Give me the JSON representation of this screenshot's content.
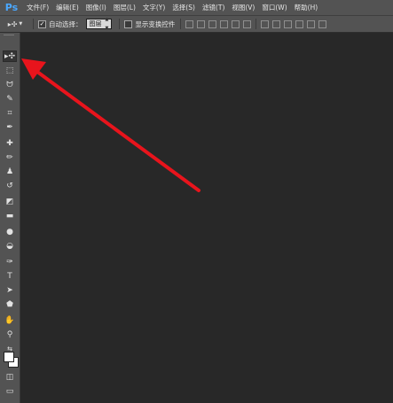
{
  "app": {
    "logo": "Ps"
  },
  "menu": [
    {
      "label": "文件(F)"
    },
    {
      "label": "编辑(E)"
    },
    {
      "label": "图像(I)"
    },
    {
      "label": "图层(L)"
    },
    {
      "label": "文字(Y)"
    },
    {
      "label": "选择(S)"
    },
    {
      "label": "滤镜(T)"
    },
    {
      "label": "视图(V)"
    },
    {
      "label": "窗口(W)"
    },
    {
      "label": "帮助(H)"
    }
  ],
  "options": {
    "tool_preset_icon": "move-tool-icon",
    "auto_select_checked": true,
    "auto_select_label": "自动选择：",
    "auto_select_value": "图层",
    "transform_checked": false,
    "transform_label": "显示变换控件"
  },
  "toolbar": {
    "tools": [
      {
        "name": "move-tool",
        "icon": "▸✣",
        "active": true
      },
      {
        "name": "marquee-tool",
        "icon": "⬚"
      },
      {
        "name": "lasso-tool",
        "icon": "ᗢ"
      },
      {
        "name": "quick-select-tool",
        "icon": "✎"
      },
      {
        "name": "crop-tool",
        "icon": "⌗"
      },
      {
        "name": "eyedropper-tool",
        "icon": "✒"
      },
      {
        "name": "healing-brush-tool",
        "icon": "✚"
      },
      {
        "name": "brush-tool",
        "icon": "✏"
      },
      {
        "name": "clone-stamp-tool",
        "icon": "♟"
      },
      {
        "name": "history-brush-tool",
        "icon": "↺"
      },
      {
        "name": "eraser-tool",
        "icon": "◩"
      },
      {
        "name": "gradient-tool",
        "icon": "▬"
      },
      {
        "name": "blur-tool",
        "icon": "●"
      },
      {
        "name": "dodge-tool",
        "icon": "◒"
      },
      {
        "name": "pen-tool",
        "icon": "✑"
      },
      {
        "name": "type-tool",
        "icon": "T"
      },
      {
        "name": "path-select-tool",
        "icon": "➤"
      },
      {
        "name": "shape-tool",
        "icon": "⬟"
      },
      {
        "name": "hand-tool",
        "icon": "✋"
      },
      {
        "name": "zoom-tool",
        "icon": "⚲"
      }
    ],
    "swap_icon": "⇆",
    "quick_mask_icon": "◫",
    "screen_mode_icon": "▭"
  },
  "annotation": {
    "color": "#e8141c"
  }
}
